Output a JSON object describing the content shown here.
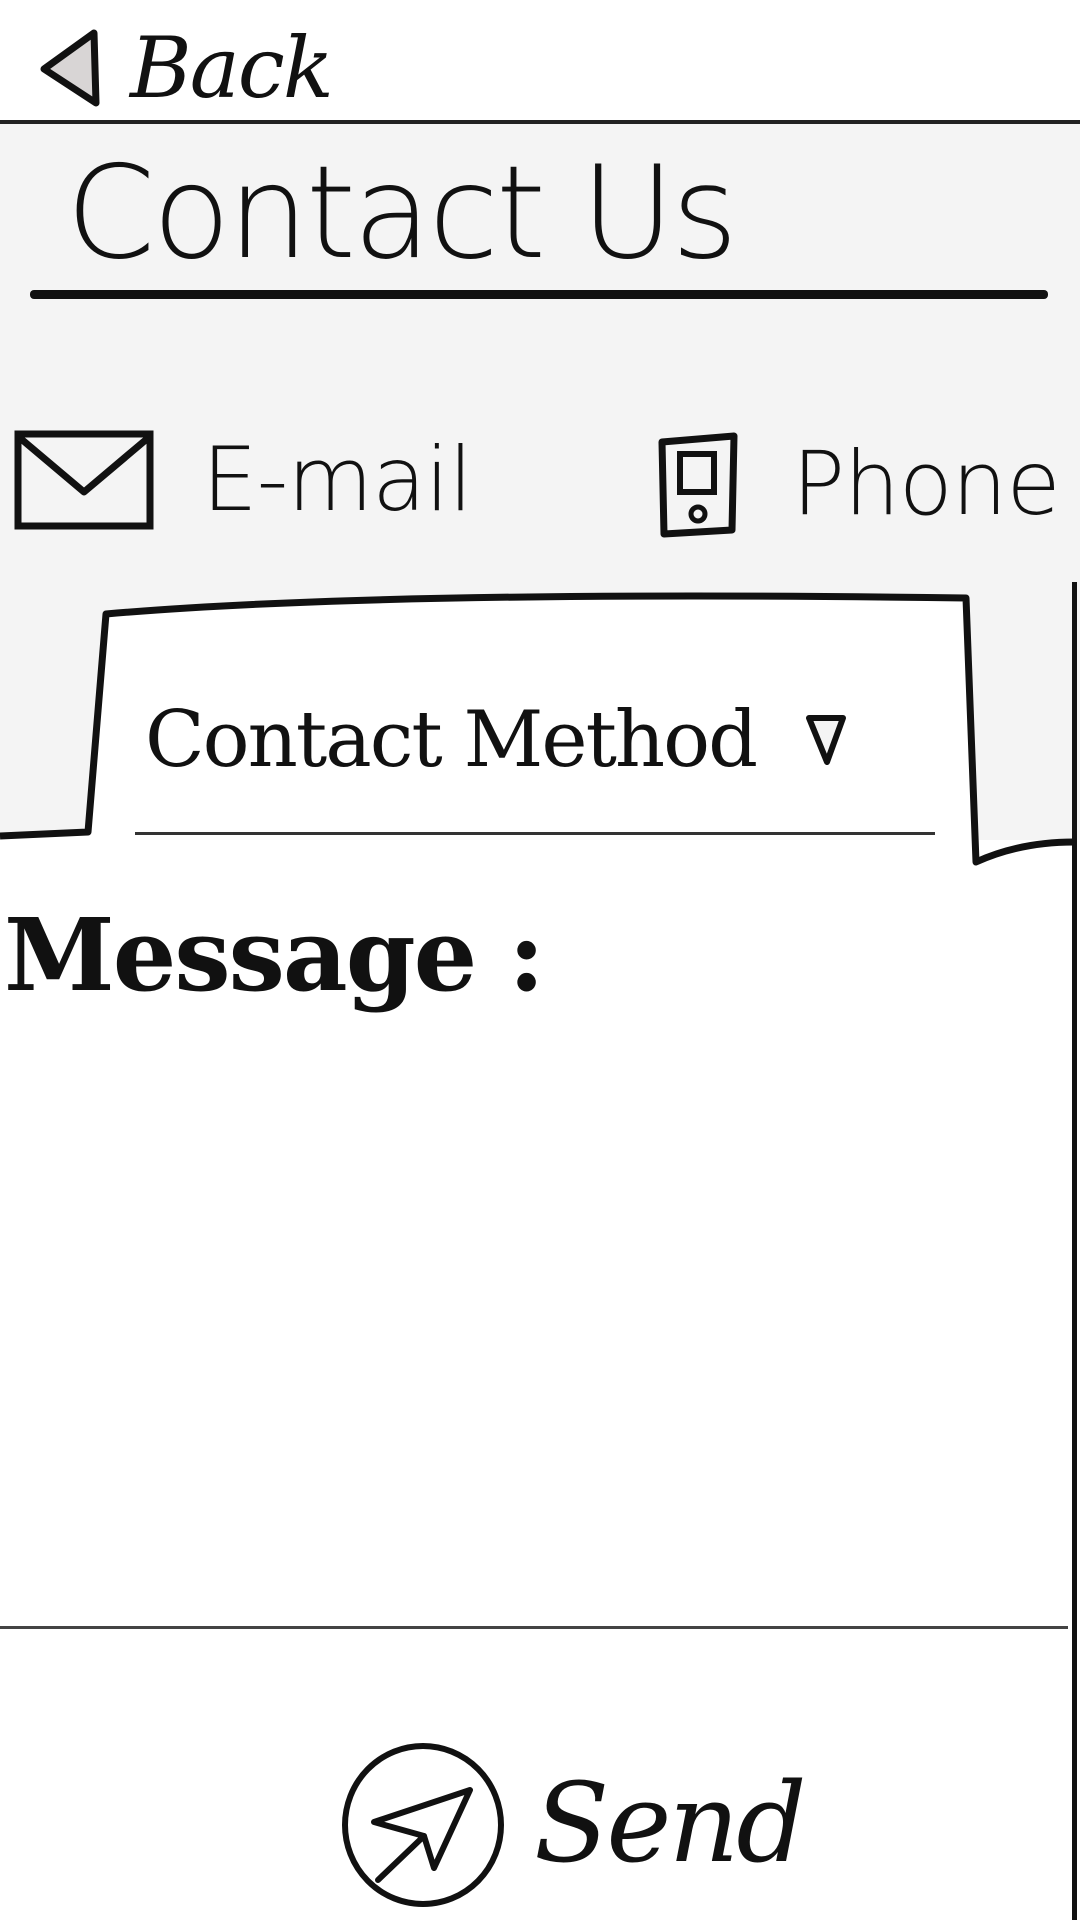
{
  "header": {
    "back_label": "Back"
  },
  "page": {
    "title": "Contact Us"
  },
  "contact_methods": {
    "email_label": "E-mail",
    "phone_label": "Phone",
    "select_label": "Contact Method"
  },
  "message": {
    "label": "Message :",
    "value": "",
    "placeholder": ""
  },
  "actions": {
    "send_label": "Send"
  },
  "icons": {
    "back": "back-triangle-icon",
    "email": "envelope-icon",
    "phone": "phone-icon",
    "dropdown": "dropdown-triangle-icon",
    "send": "paper-plane-icon"
  }
}
